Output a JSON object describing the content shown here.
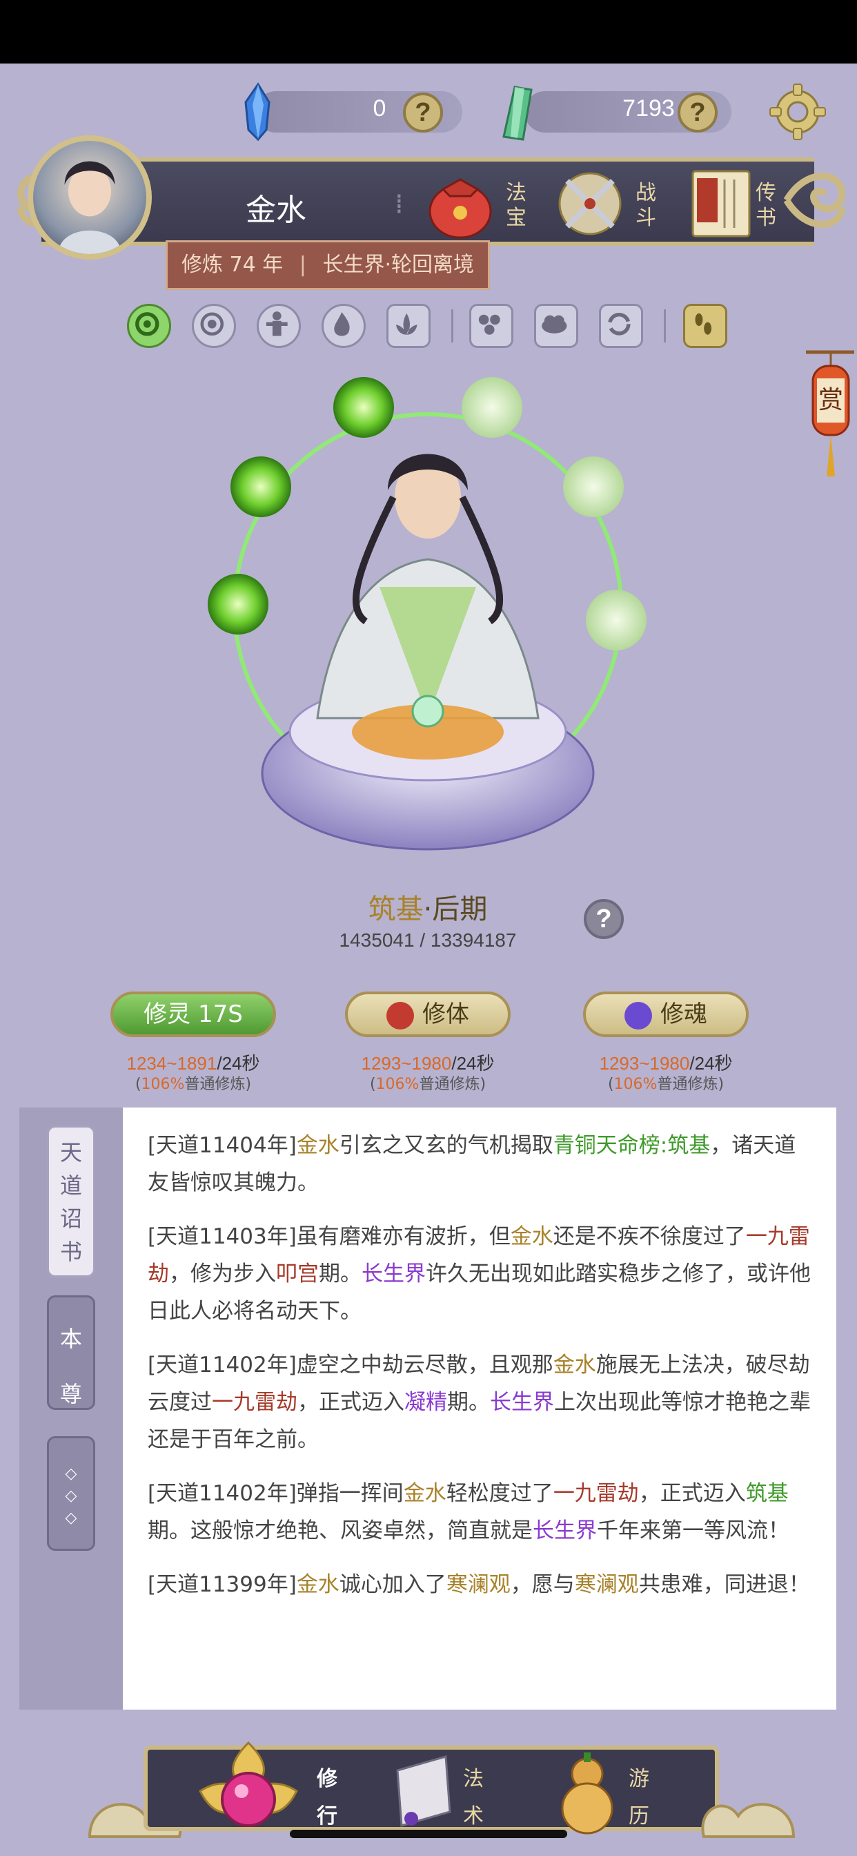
{
  "currency": {
    "spirit_stones": "0",
    "jade": "7193"
  },
  "player": {
    "name": "金水",
    "cultivation_years": "修炼 74 年",
    "world": "长生界·轮回离境",
    "menu": [
      {
        "label_top": "法",
        "label_bottom": "宝"
      },
      {
        "label_top": "战",
        "label_bottom": "斗"
      },
      {
        "label_top": "传",
        "label_bottom": "书"
      }
    ],
    "sep_glyph": "⁞"
  },
  "realm": {
    "major": "筑基",
    "dot": "·",
    "minor": "后期",
    "progress": "1435041 / 13394187"
  },
  "training": [
    {
      "label": "修灵 17S",
      "rate_range": "1234~1891",
      "rate_unit": "/24秒",
      "note_pct": "106%",
      "note_text": "普通修炼"
    },
    {
      "label": "修体",
      "rate_range": "1293~1980",
      "rate_unit": "/24秒",
      "note_pct": "106%",
      "note_text": "普通修炼"
    },
    {
      "label": "修魂",
      "rate_range": "1293~1980",
      "rate_unit": "/24秒",
      "note_pct": "106%",
      "note_text": "普通修炼"
    }
  ],
  "side_tabs": {
    "edict": "天道诏书",
    "self": "本尊",
    "more": "◇◇◇"
  },
  "log": [
    {
      "parts": [
        "[天道11404年]",
        "金水",
        "引玄之又玄的气机揭取",
        "青铜天命榜:筑基",
        "，诸天道友皆惊叹其魄力。"
      ]
    },
    {
      "parts": [
        "[天道11403年]虽有磨难亦有波折，但",
        "金水",
        "还是不疾不徐度过了",
        "一九雷劫",
        "，修为步入",
        "叩宫",
        "期。",
        "长生界",
        "许久无出现如此踏实稳步之修了，或许他日此人必将名动天下。"
      ]
    },
    {
      "parts": [
        "[天道11402年]虚空之中劫云尽散，且观那",
        "金水",
        "施展无上法决，破尽劫云度过",
        "一九雷劫",
        "，正式迈入",
        "凝精",
        "期。",
        "长生界",
        "上次出现此等惊才艳艳之辈还是于百年之前。"
      ]
    },
    {
      "parts": [
        "[天道11402年]弹指一挥间",
        "金水",
        "轻松度过了",
        "一九雷劫",
        "，正式迈入",
        "筑基",
        "期。这般惊才绝艳、风姿卓然，简直就是",
        "长生界",
        "千年来第一等风流！"
      ]
    },
    {
      "parts": [
        "[天道11399年]",
        "金水",
        "诚心加入了",
        "寒澜观",
        "，愿与",
        "寒澜观",
        "共患难，同进退！"
      ]
    }
  ],
  "bottom_nav": [
    {
      "top": "修",
      "bottom": "行"
    },
    {
      "top": "法",
      "bottom": "术"
    },
    {
      "top": "游",
      "bottom": "历"
    }
  ],
  "lantern_label": "赏",
  "help_glyph": "?",
  "colors": {
    "accent_gold": "#cbb985",
    "green_active": "#8ed66b",
    "background": "#b7b2cf"
  }
}
